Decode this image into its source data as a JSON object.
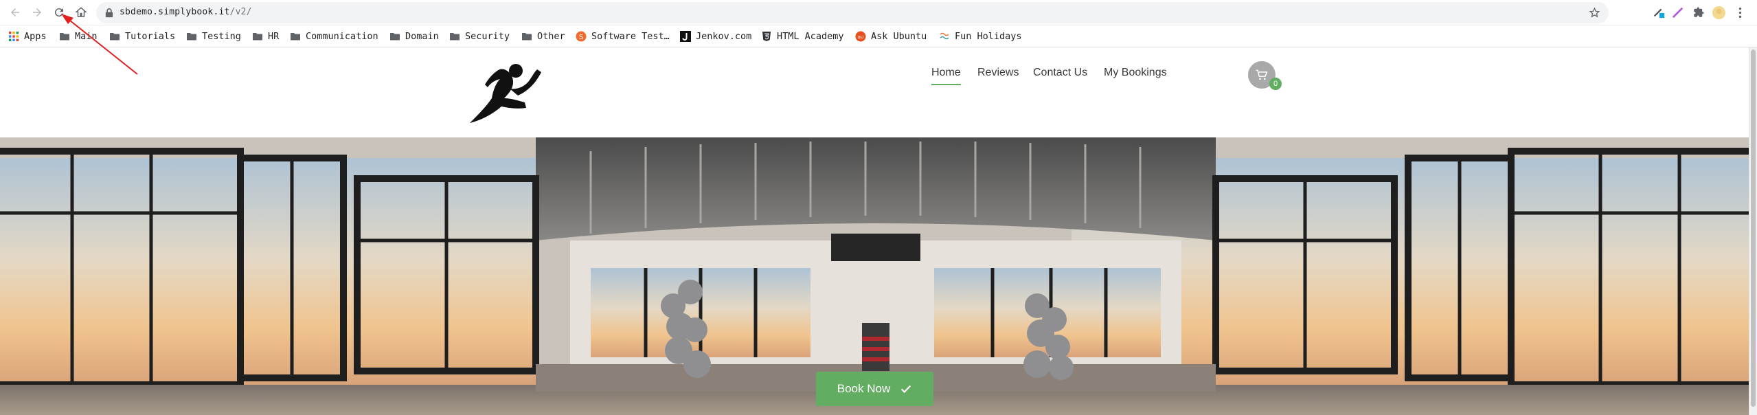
{
  "browser": {
    "url_host": "sbdemo.simplybook.it",
    "url_path": "/v2/"
  },
  "bookmarks": [
    {
      "label": "Apps",
      "icon": "apps-grid-icon"
    },
    {
      "label": "Main",
      "icon": "folder-icon"
    },
    {
      "label": "Tutorials",
      "icon": "folder-icon"
    },
    {
      "label": "Testing",
      "icon": "folder-icon"
    },
    {
      "label": "HR",
      "icon": "folder-icon"
    },
    {
      "label": "Communication",
      "icon": "folder-icon"
    },
    {
      "label": "Domain",
      "icon": "folder-icon"
    },
    {
      "label": "Security",
      "icon": "folder-icon"
    },
    {
      "label": "Other",
      "icon": "folder-icon"
    },
    {
      "label": "Software Test…",
      "icon": "software-test-favicon"
    },
    {
      "label": "Jenkov.com",
      "icon": "jenkov-favicon"
    },
    {
      "label": "HTML Academy",
      "icon": "html-academy-favicon"
    },
    {
      "label": "Ask Ubuntu",
      "icon": "ask-ubuntu-favicon"
    },
    {
      "label": "Fun Holidays",
      "icon": "fun-holidays-favicon"
    }
  ],
  "site": {
    "nav": [
      "Home",
      "Reviews",
      "Contact Us",
      "My Bookings"
    ],
    "active_nav": "Home",
    "cart_count": "0",
    "book_now_label": "Book Now",
    "accent_color": "#62ad62"
  }
}
